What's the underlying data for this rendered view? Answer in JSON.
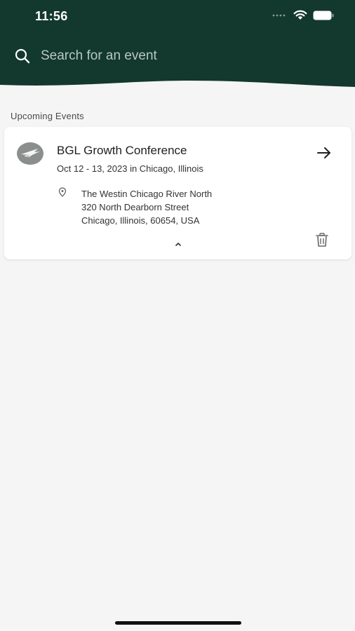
{
  "status_bar": {
    "time": "11:56"
  },
  "header": {
    "bg_color": "#13382e",
    "search": {
      "placeholder": "Search for an event",
      "icon": "search-icon"
    }
  },
  "section": {
    "title": "Upcoming Events"
  },
  "events": [
    {
      "title": "BGL Growth Conference",
      "date": "Oct 12 - 13, 2023 in Chicago, Illinois",
      "address": {
        "line1": "The Westin Chicago River North",
        "line2": "320 North Dearborn Street",
        "line3": "Chicago, Illinois, 60654, USA"
      }
    }
  ]
}
